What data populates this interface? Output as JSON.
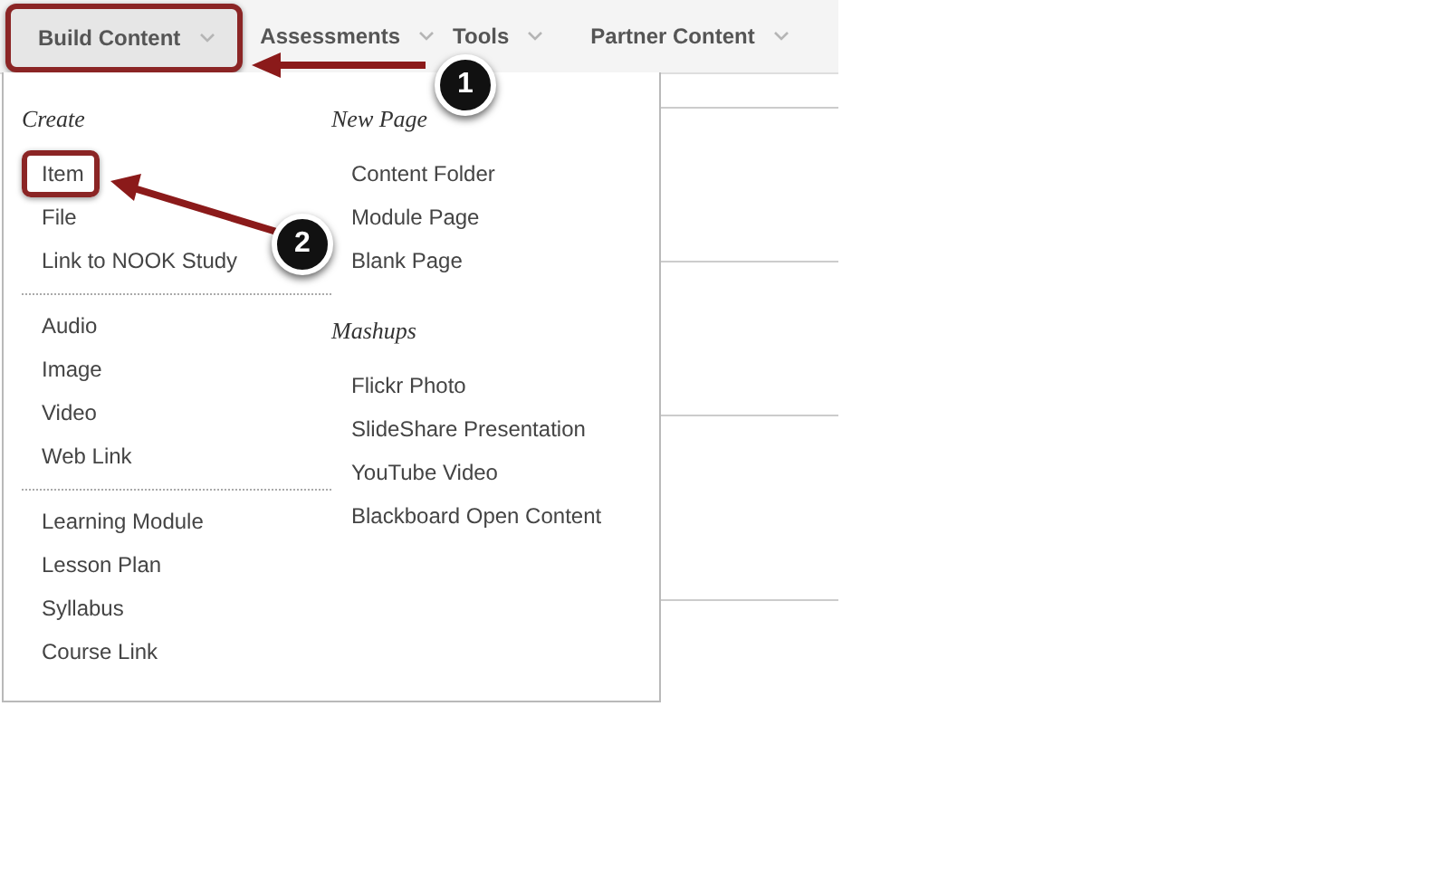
{
  "nav": {
    "items": [
      {
        "label": "Build Content",
        "selected": true,
        "highlighted": true
      },
      {
        "label": "Assessments",
        "selected": false,
        "highlighted": false
      },
      {
        "label": "Tools",
        "selected": false,
        "highlighted": false
      },
      {
        "label": "Partner Content",
        "selected": false,
        "highlighted": false
      }
    ]
  },
  "menu": {
    "columns": [
      {
        "sections": [
          {
            "header": "Create",
            "groups": [
              [
                {
                  "label": "Item",
                  "highlighted": true
                },
                {
                  "label": "File",
                  "highlighted": false
                },
                {
                  "label": "Link to NOOK Study",
                  "highlighted": false
                }
              ],
              [
                {
                  "label": "Audio",
                  "highlighted": false
                },
                {
                  "label": "Image",
                  "highlighted": false
                },
                {
                  "label": "Video",
                  "highlighted": false
                },
                {
                  "label": "Web Link",
                  "highlighted": false
                }
              ],
              [
                {
                  "label": "Learning Module",
                  "highlighted": false
                },
                {
                  "label": "Lesson Plan",
                  "highlighted": false
                },
                {
                  "label": "Syllabus",
                  "highlighted": false
                },
                {
                  "label": "Course Link",
                  "highlighted": false
                }
              ]
            ]
          }
        ]
      },
      {
        "sections": [
          {
            "header": "New Page",
            "groups": [
              [
                {
                  "label": "Content Folder",
                  "highlighted": false
                },
                {
                  "label": "Module Page",
                  "highlighted": false
                },
                {
                  "label": "Blank Page",
                  "highlighted": false
                }
              ]
            ]
          },
          {
            "header": "Mashups",
            "groups": [
              [
                {
                  "label": "Flickr Photo",
                  "highlighted": false
                },
                {
                  "label": "SlideShare Presentation",
                  "highlighted": false
                },
                {
                  "label": "YouTube Video",
                  "highlighted": false
                },
                {
                  "label": "Blackboard Open Content",
                  "highlighted": false
                }
              ]
            ]
          }
        ]
      }
    ]
  },
  "callouts": [
    {
      "label": "1"
    },
    {
      "label": "2"
    }
  ]
}
